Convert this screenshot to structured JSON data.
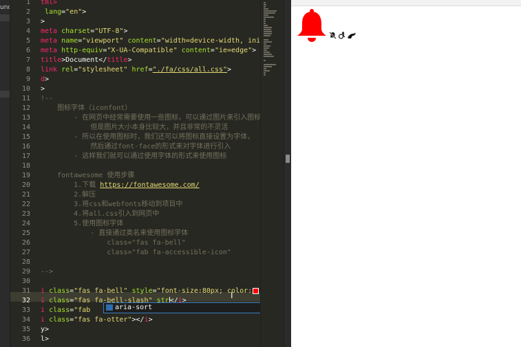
{
  "sidebar": {
    "label": "und"
  },
  "editor": {
    "line_numbers": [
      "1",
      "2",
      "3",
      "4",
      "5",
      "6",
      "7",
      "8",
      "9",
      "10",
      "11",
      "12",
      "13",
      "14",
      "15",
      "16",
      "17",
      "18",
      "19",
      "20",
      "21",
      "22",
      "23",
      "24",
      "25",
      "26",
      "27",
      "28",
      "29",
      "30",
      "31",
      "32",
      "33",
      "34",
      "35",
      "36"
    ],
    "current_line": "32",
    "lines": [
      [
        {
          "c": "t",
          "t": "tml>"
        }
      ],
      [
        {
          "c": "p",
          "t": " "
        },
        {
          "c": "a",
          "t": "lang"
        },
        {
          "c": "p",
          "t": "="
        },
        {
          "c": "s",
          "t": "\"en\""
        },
        {
          "c": "p",
          "t": ">"
        }
      ],
      [
        {
          "c": "p",
          "t": ">"
        }
      ],
      [
        {
          "c": "t",
          "t": "meta"
        },
        {
          "c": "p",
          "t": " "
        },
        {
          "c": "a",
          "t": "charset"
        },
        {
          "c": "p",
          "t": "="
        },
        {
          "c": "s",
          "t": "\"UTF-8\""
        },
        {
          "c": "p",
          "t": ">"
        }
      ],
      [
        {
          "c": "t",
          "t": "meta"
        },
        {
          "c": "p",
          "t": " "
        },
        {
          "c": "a",
          "t": "name"
        },
        {
          "c": "p",
          "t": "="
        },
        {
          "c": "s",
          "t": "\"viewport\""
        },
        {
          "c": "p",
          "t": " "
        },
        {
          "c": "a",
          "t": "content"
        },
        {
          "c": "p",
          "t": "="
        },
        {
          "c": "s",
          "t": "\"width=device-width, initial"
        }
      ],
      [
        {
          "c": "t",
          "t": "meta"
        },
        {
          "c": "p",
          "t": " "
        },
        {
          "c": "a",
          "t": "http-equiv"
        },
        {
          "c": "p",
          "t": "="
        },
        {
          "c": "s",
          "t": "\"X-UA-Compatible\""
        },
        {
          "c": "p",
          "t": " "
        },
        {
          "c": "a",
          "t": "content"
        },
        {
          "c": "p",
          "t": "="
        },
        {
          "c": "s",
          "t": "\"ie=edge\""
        },
        {
          "c": "p",
          "t": ">"
        }
      ],
      [
        {
          "c": "t",
          "t": "title"
        },
        {
          "c": "p",
          "t": ">Document</"
        },
        {
          "c": "t",
          "t": "title"
        },
        {
          "c": "p",
          "t": ">"
        }
      ],
      [
        {
          "c": "t",
          "t": "link"
        },
        {
          "c": "p",
          "t": " "
        },
        {
          "c": "a",
          "t": "rel"
        },
        {
          "c": "p",
          "t": "="
        },
        {
          "c": "s",
          "t": "\"stylesheet\""
        },
        {
          "c": "p",
          "t": " "
        },
        {
          "c": "a",
          "t": "href"
        },
        {
          "c": "p",
          "t": "="
        },
        {
          "c": "u",
          "t": "\"./fa/css/all.css\""
        },
        {
          "c": "p",
          "t": ">"
        }
      ],
      [
        {
          "c": "t",
          "t": "d"
        },
        {
          "c": "p",
          "t": ">"
        }
      ],
      [
        {
          "c": "p",
          "t": ">"
        }
      ],
      [
        {
          "c": "c",
          "t": "!--"
        }
      ],
      [
        {
          "c": "c",
          "t": "    图标字体（iconfont）"
        }
      ],
      [
        {
          "c": "c",
          "t": "        - 在网页中经常需要使用一些图标，可以通过图片来引入图标"
        }
      ],
      [
        {
          "c": "c",
          "t": "            但是图片大小本身比较大，并且非常的不灵活"
        }
      ],
      [
        {
          "c": "c",
          "t": "        - 所以在使用图标时，我们还可以将图标直接设置为字体，"
        }
      ],
      [
        {
          "c": "c",
          "t": "            然后通过font-face的形式来对字体进行引入"
        }
      ],
      [
        {
          "c": "c",
          "t": "        - 这样我们就可以通过使用字体的形式来使用图标"
        }
      ],
      [
        {
          "c": "c",
          "t": ""
        }
      ],
      [
        {
          "c": "c",
          "t": "    fontawesome 使用步骤"
        }
      ],
      [
        {
          "c": "c",
          "t": "        1.下载 "
        },
        {
          "c": "u",
          "t": "https://fontawesome.com/"
        }
      ],
      [
        {
          "c": "c",
          "t": "        2.解压"
        }
      ],
      [
        {
          "c": "c",
          "t": "        3.将css和webfonts移动到项目中"
        }
      ],
      [
        {
          "c": "c",
          "t": "        4.将all.css引入到网页中"
        }
      ],
      [
        {
          "c": "c",
          "t": "        5.使用图标字体"
        }
      ],
      [
        {
          "c": "c",
          "t": "            - 直接通过类名来使用图标字体"
        }
      ],
      [
        {
          "c": "c",
          "t": "                class=\"fas fa-bell\""
        }
      ],
      [
        {
          "c": "c",
          "t": "                class=\"fab fa-accessible-icon\""
        }
      ],
      [
        {
          "c": "c",
          "t": ""
        }
      ],
      [
        {
          "c": "c",
          "t": "-->"
        }
      ],
      [
        {
          "c": "p",
          "t": ""
        }
      ],
      [
        {
          "c": "t",
          "t": "i"
        },
        {
          "c": "p",
          "t": " "
        },
        {
          "c": "a",
          "t": "class"
        },
        {
          "c": "p",
          "t": "="
        },
        {
          "c": "s",
          "t": "\"fas fa-bell\""
        },
        {
          "c": "p",
          "t": " "
        },
        {
          "c": "a",
          "t": "style"
        },
        {
          "c": "p",
          "t": "="
        },
        {
          "c": "s",
          "t": "\"font-size:80px; color:"
        },
        {
          "c": "sw",
          "t": ""
        },
        {
          "c": "s",
          "t": "red;"
        }
      ],
      [
        {
          "c": "t",
          "t": "i"
        },
        {
          "c": "p",
          "t": " "
        },
        {
          "c": "a",
          "t": "class"
        },
        {
          "c": "p",
          "t": "="
        },
        {
          "c": "s",
          "t": "\"fas fa-bell-slash\""
        },
        {
          "c": "p",
          "t": " "
        },
        {
          "c": "a",
          "t": "str"
        },
        {
          "c": "cur",
          "t": ""
        },
        {
          "c": "p",
          "t": "</"
        },
        {
          "c": "t",
          "t": "i"
        },
        {
          "c": "p",
          "t": ">"
        }
      ],
      [
        {
          "c": "t",
          "t": "i"
        },
        {
          "c": "p",
          "t": " "
        },
        {
          "c": "a",
          "t": "class"
        },
        {
          "c": "p",
          "t": "="
        },
        {
          "c": "s",
          "t": "\"fab "
        }
      ],
      [
        {
          "c": "t",
          "t": "i"
        },
        {
          "c": "p",
          "t": " "
        },
        {
          "c": "a",
          "t": "class"
        },
        {
          "c": "p",
          "t": "="
        },
        {
          "c": "s",
          "t": "\"fas fa-otter\""
        },
        {
          "c": "p",
          "t": "></"
        },
        {
          "c": "t",
          "t": "i"
        },
        {
          "c": "p",
          "t": ">"
        }
      ],
      [
        {
          "c": "p",
          "t": "y>"
        }
      ],
      [
        {
          "c": "p",
          "t": "l>"
        }
      ]
    ]
  },
  "autocomplete": {
    "suggestion": "aria-sort",
    "info_icon": "info-icon"
  },
  "preview": {
    "icons": [
      "bell-icon",
      "bell-slash-icon",
      "accessible-icon",
      "otter-icon"
    ],
    "bell_color": "#ff0000"
  }
}
